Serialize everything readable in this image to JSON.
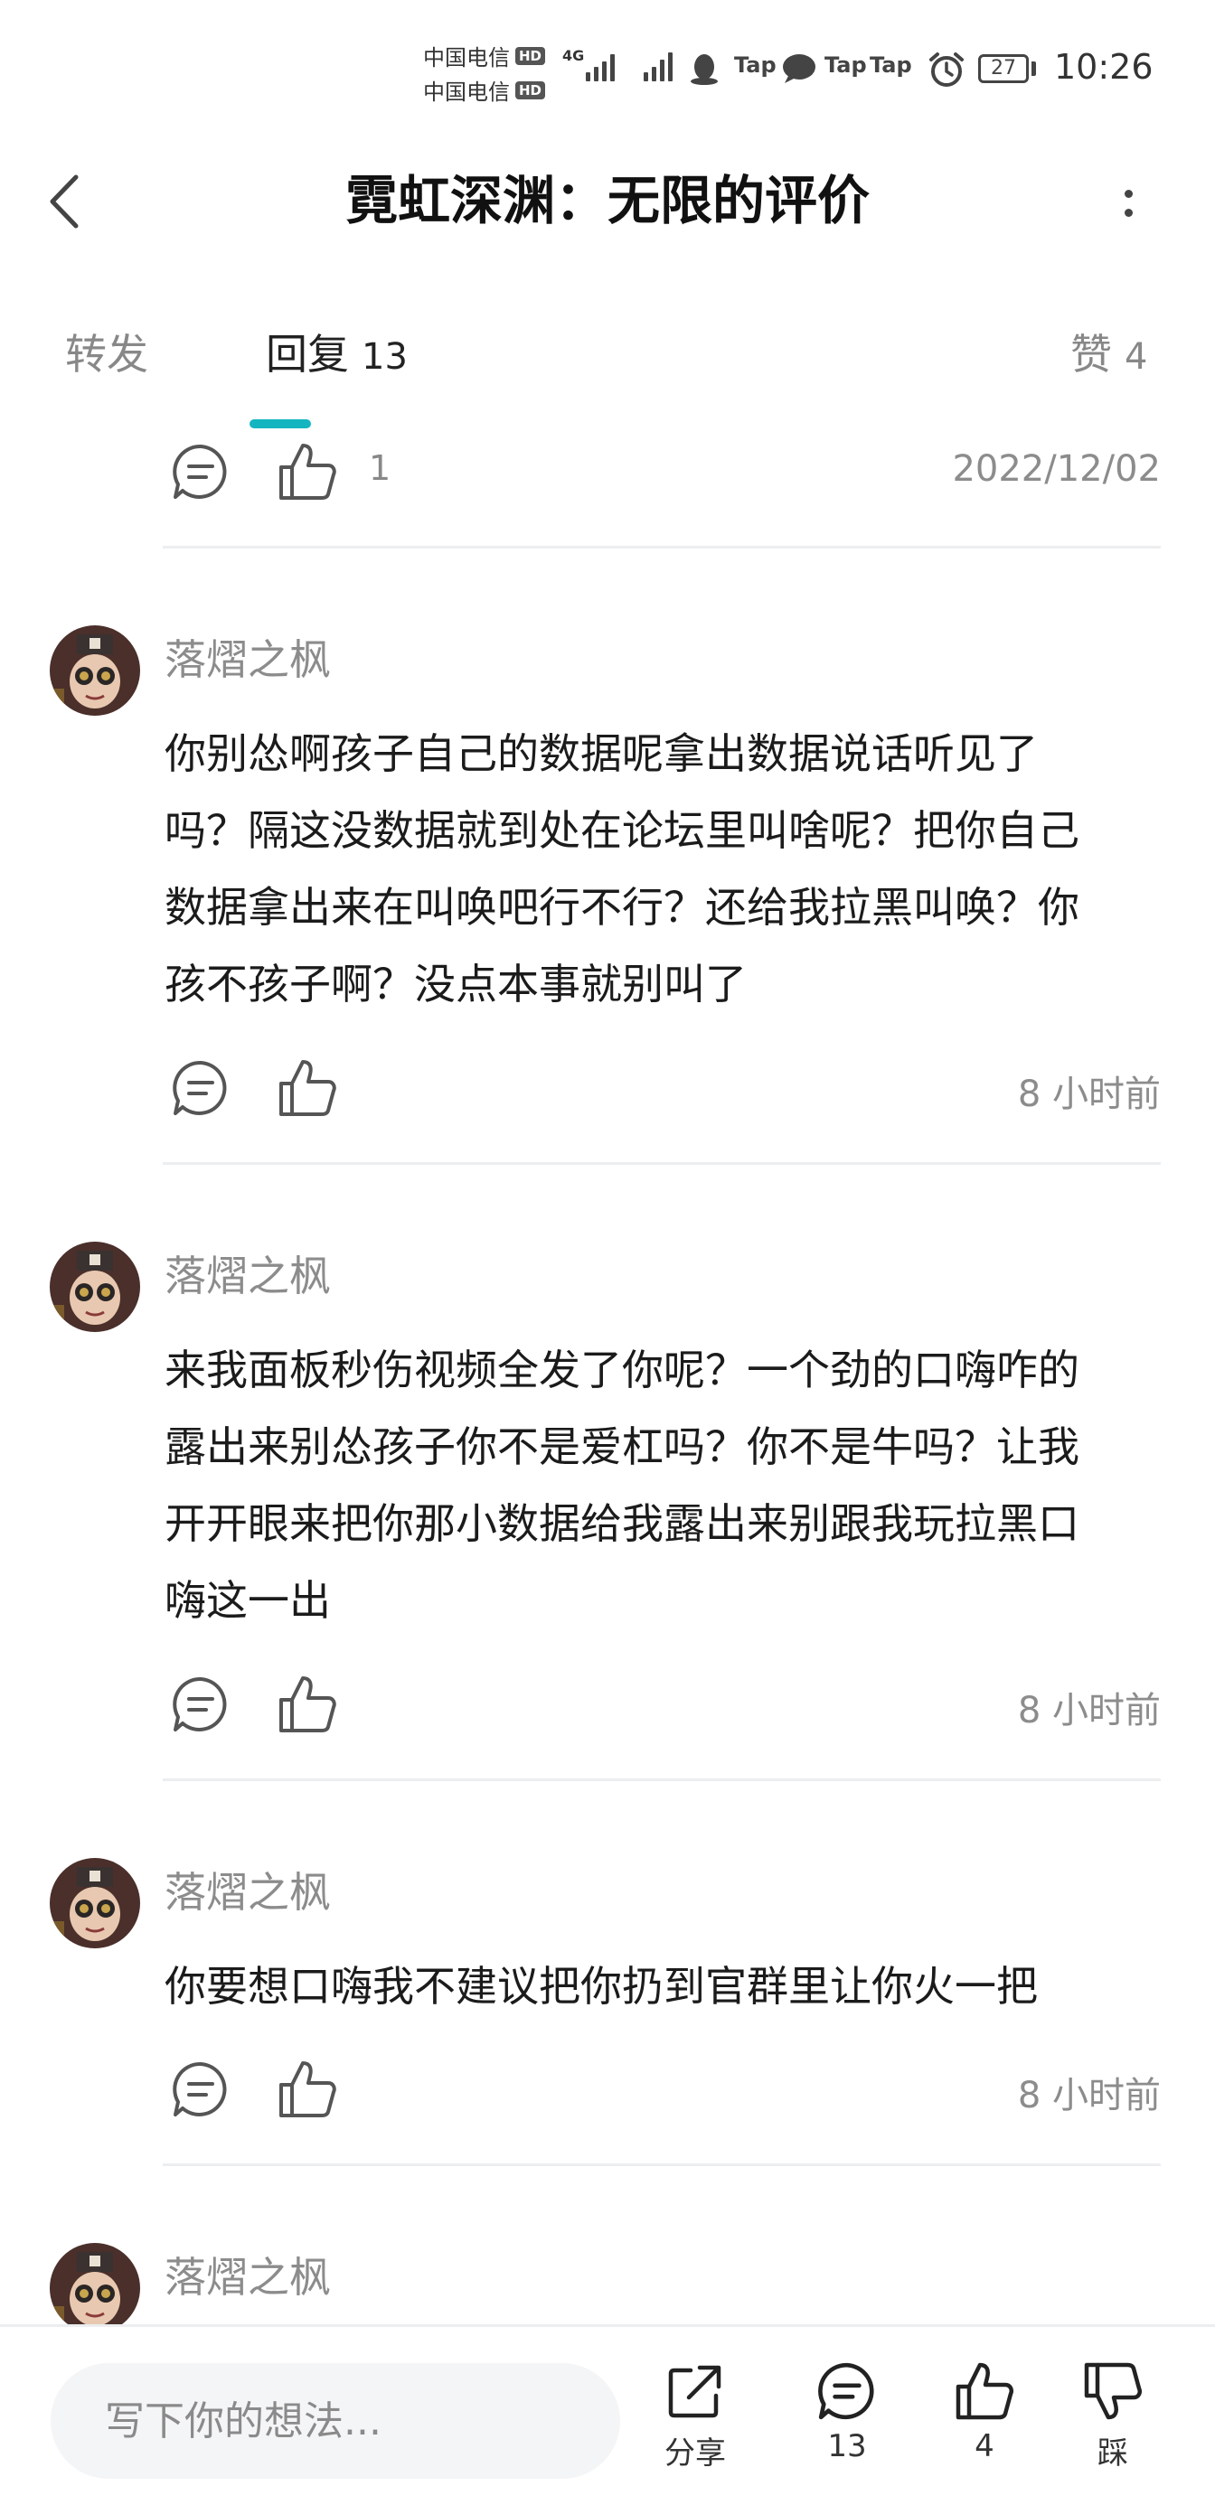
{
  "status_bar": {
    "carrier_1": "中国电信",
    "carrier_2": "中国电信",
    "hd_badge": "HD",
    "network_type": "4G",
    "taptap_1": "Tap",
    "taptap_2": "Tap",
    "taptap_3": "Tap",
    "battery": "27",
    "time": "10:26",
    "icons": [
      "signal-icon",
      "qq-icon",
      "taptap-icon",
      "chat-bubble-icon",
      "alarm-icon",
      "battery-icon"
    ]
  },
  "header": {
    "title": "霓虹深渊：无限的评价",
    "icons": [
      "back-arrow-icon",
      "more-vertical-icon"
    ]
  },
  "tabs": [
    {
      "label": "转发",
      "count": ""
    },
    {
      "label": "回复",
      "count": "13"
    },
    {
      "label": "赞",
      "count": "4"
    }
  ],
  "accent_color": "#14b5c0",
  "top_row": {
    "likes": "1",
    "date": "2022/12/02"
  },
  "comments": [
    {
      "author": "落熠之枫",
      "lines": [
        "你别怂啊孩子自己的数据呢拿出数据说话听见了",
        "吗？隔这没数据就到处在论坛里叫啥呢？把你自己",
        "数据拿出来在叫唤吧行不行？还给我拉黑叫唤？你",
        "孩不孩子啊？没点本事就别叫了"
      ],
      "time": "8 小时前"
    },
    {
      "author": "落熠之枫",
      "lines": [
        "来我面板秒伤视频全发了你呢？一个劲的口嗨咋的",
        "露出来别怂孩子你不是爱杠吗？你不是牛吗？让我",
        "开开眼来把你那小数据给我露出来别跟我玩拉黑口",
        "嗨这一出"
      ],
      "time": "8 小时前"
    },
    {
      "author": "落熠之枫",
      "lines": [
        "你要想口嗨我不建议把你扔到官群里让你火一把"
      ],
      "time": "8 小时前"
    },
    {
      "author": "落熠之枫"
    }
  ],
  "bottom_bar": {
    "input_placeholder": "写下你的想法...",
    "share_label": "分享",
    "comment_count": "13",
    "like_count": "4",
    "dislike_label": "踩"
  }
}
